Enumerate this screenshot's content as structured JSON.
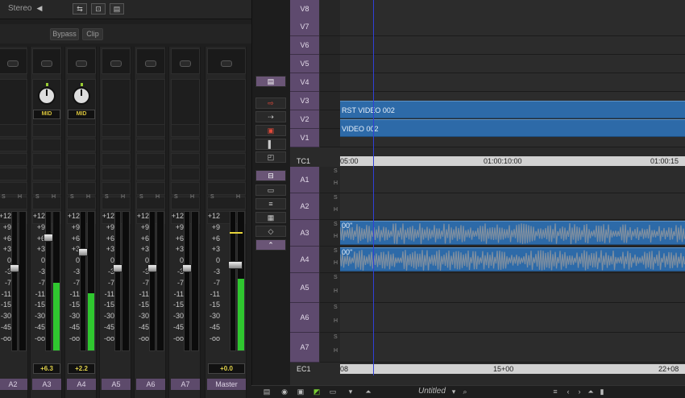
{
  "mixer": {
    "output_label": "Stereo",
    "bypass_label": "Bypass",
    "clip_label": "Clip",
    "scale_marks": [
      "+12",
      "+9",
      "+6",
      "+3",
      "0",
      "-3",
      "-7",
      "-11",
      "-15",
      "-30",
      "-45",
      "-oo"
    ],
    "strips": [
      {
        "name": "A2",
        "volume": "",
        "knob": false,
        "pan": "",
        "meter_level": 0
      },
      {
        "name": "A3",
        "volume": "+6.3",
        "knob": true,
        "pan": "MID",
        "meter_level": 0.49
      },
      {
        "name": "A4",
        "volume": "+2.2",
        "knob": true,
        "pan": "MID",
        "meter_level": 0.41
      },
      {
        "name": "A5",
        "volume": "",
        "knob": false,
        "pan": "",
        "meter_level": 0
      },
      {
        "name": "A6",
        "volume": "",
        "knob": false,
        "pan": "",
        "meter_level": 0
      },
      {
        "name": "A7",
        "volume": "",
        "knob": false,
        "pan": "",
        "meter_level": 0
      },
      {
        "name": "Master",
        "volume": "+0.0",
        "knob": false,
        "pan": "",
        "meter_level": 0.52
      }
    ]
  },
  "timeline": {
    "video_tracks": [
      "V8",
      "V7",
      "V6",
      "V5",
      "V4",
      "V3",
      "V2",
      "V1"
    ],
    "tc_label": "TC1",
    "ec_label": "EC1",
    "tc_marks": [
      "05:00",
      "01:00:10:00",
      "01:00:15"
    ],
    "ec_marks": [
      "08",
      "15+00",
      "22+08"
    ],
    "audio_tracks": [
      "A1",
      "A2",
      "A3",
      "A4",
      "A5",
      "A6",
      "A7"
    ],
    "clips": {
      "v3": "RST VIDEO 002",
      "v2": "VIDEO 002",
      "a3": "00\"",
      "a4": "00\""
    },
    "solo_label": "S",
    "mute_label": "H"
  },
  "bottombar": {
    "sequence_name": "Untitled"
  },
  "colors": {
    "track_header": "#5e4a6e",
    "clip_blue": "#2d6aa8",
    "meter_green": "#2fc72f",
    "playhead": "#3040d8"
  }
}
